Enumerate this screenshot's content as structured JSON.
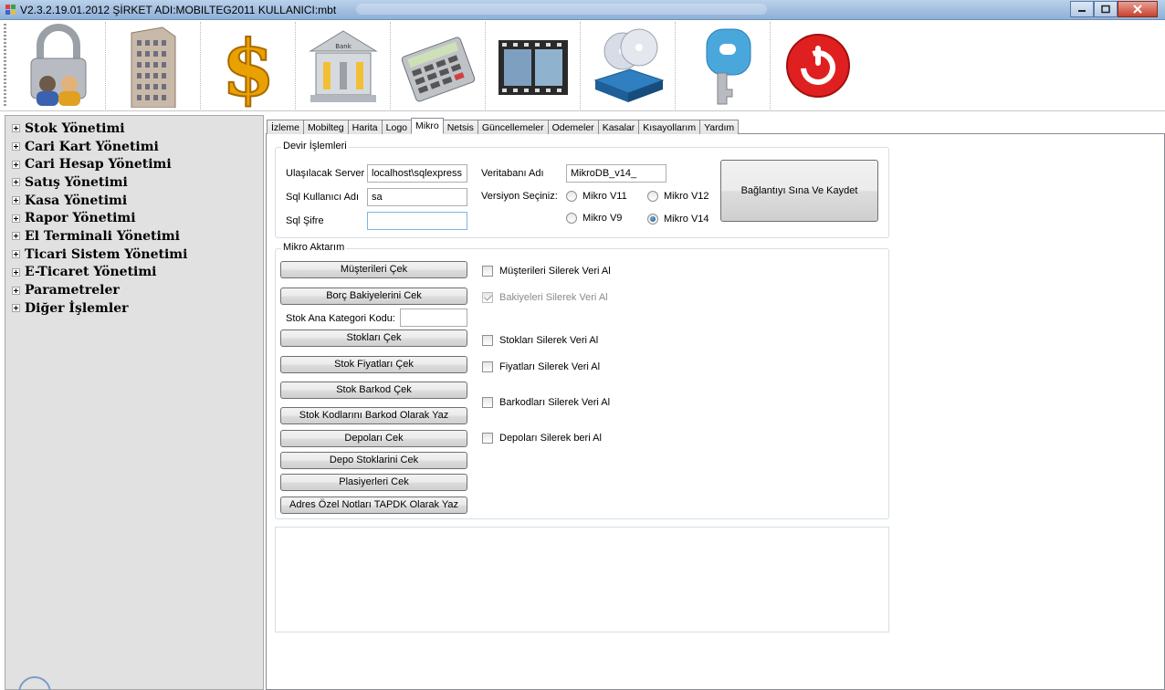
{
  "window": {
    "title": "V2.3.2.19.01.2012 ŞİRKET ADI:MOBILTEG2011 KULLANICI:mbt",
    "icon": "app-icon",
    "buttons": [
      "minimize-icon",
      "maximize-icon",
      "close-icon"
    ]
  },
  "toolbar": {
    "buttons": [
      {
        "icon": "lock-users-icon"
      },
      {
        "icon": "building-icon"
      },
      {
        "icon": "dollar-icon"
      },
      {
        "icon": "bank-icon",
        "text": "Bank"
      },
      {
        "icon": "calculator-icon"
      },
      {
        "icon": "film-icon"
      },
      {
        "icon": "database-disks-icon"
      },
      {
        "icon": "key-icon"
      },
      {
        "icon": "power-icon"
      }
    ]
  },
  "sidebar": {
    "items": [
      {
        "label": "Stok Yönetimi"
      },
      {
        "label": "Cari Kart Yönetimi"
      },
      {
        "label": "Cari Hesap Yönetimi"
      },
      {
        "label": "Satış Yönetimi"
      },
      {
        "label": "Kasa Yönetimi"
      },
      {
        "label": "Rapor Yönetimi"
      },
      {
        "label": "El Terminali Yönetimi"
      },
      {
        "label": "Ticari Sistem Yönetimi"
      },
      {
        "label": "E-Ticaret Yönetimi"
      },
      {
        "label": "Parametreler"
      },
      {
        "label": "Diğer İşlemler"
      }
    ]
  },
  "tabs": [
    {
      "label": "İzleme",
      "active": false
    },
    {
      "label": "Mobilteg",
      "active": false
    },
    {
      "label": "Harita",
      "active": false
    },
    {
      "label": "Logo",
      "active": false
    },
    {
      "label": "Mikro",
      "active": true
    },
    {
      "label": "Netsis",
      "active": false
    },
    {
      "label": "Güncellemeler",
      "active": false
    },
    {
      "label": "Odemeler",
      "active": false
    },
    {
      "label": "Kasalar",
      "active": false
    },
    {
      "label": "Kısayollarım",
      "active": false
    },
    {
      "label": "Yardım",
      "active": false
    }
  ],
  "devir": {
    "legend": "Devir İşlemleri",
    "server_label": "Ulaşılacak Server",
    "server_value": "localhost\\sqlexpress",
    "user_label": "Sql Kullanıcı Adı",
    "user_value": "sa",
    "password_label": "Sql Şifre",
    "password_value": "",
    "db_label": "Veritabanı Adı",
    "db_value": "MikroDB_v14_",
    "version_label": "Versiyon Seçiniz:",
    "versions": [
      {
        "label": "Mikro V11",
        "selected": false
      },
      {
        "label": "Mikro V12",
        "selected": false
      },
      {
        "label": "Mikro V9",
        "selected": false
      },
      {
        "label": "Mikro V14",
        "selected": true
      }
    ],
    "save_button": "Bağlantıyı Sına Ve Kaydet"
  },
  "aktarim": {
    "legend": "Mikro Aktarım",
    "buttons": {
      "musteriler": "Müşterileri Çek",
      "borc": "Borç Bakiyelerini Cek",
      "stoklar": "Stokları Çek",
      "fiyatlar": "Stok Fiyatları Çek",
      "barkod": "Stok Barkod Çek",
      "kod_barkod": "Stok Kodlarını Barkod Olarak Yaz",
      "depolar": "Depoları Cek",
      "depo_stok": "Depo Stoklarini Cek",
      "plasiyer": "Plasiyerleri Cek",
      "adres": "Adres Özel Notları TAPDK Olarak Yaz"
    },
    "kategori_label": "Stok Ana Kategori Kodu:",
    "kategori_value": "",
    "checkboxes": {
      "musteri": {
        "label": "Müşterileri Silerek Veri Al",
        "checked": false,
        "enabled": true
      },
      "bakiye": {
        "label": "Bakiyeleri Silerek Veri Al",
        "checked": true,
        "enabled": false
      },
      "stok": {
        "label": "Stokları Silerek Veri Al",
        "checked": false,
        "enabled": true
      },
      "fiyat": {
        "label": "Fiyatları Silerek Veri Al",
        "checked": false,
        "enabled": true
      },
      "barkod": {
        "label": "Barkodları Silerek Veri Al",
        "checked": false,
        "enabled": true
      },
      "depo": {
        "label": "Depoları Silerek beri Al",
        "checked": false,
        "enabled": true
      }
    }
  },
  "log": {
    "content": ""
  }
}
